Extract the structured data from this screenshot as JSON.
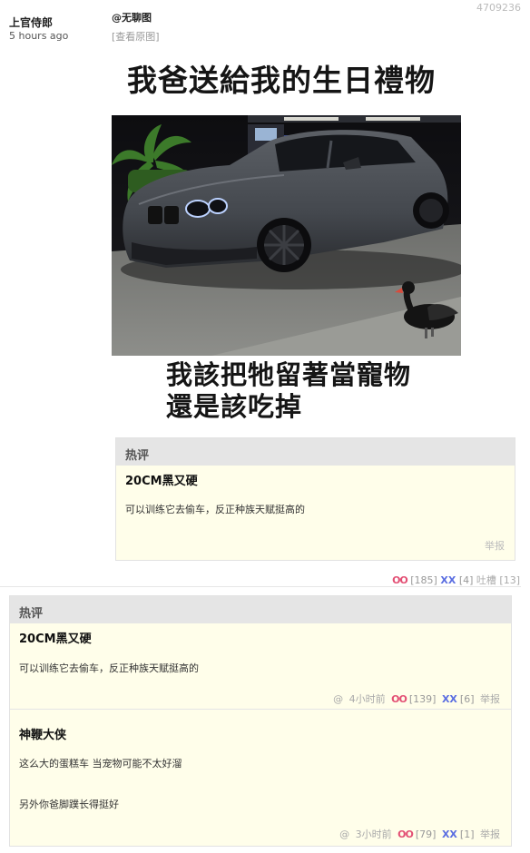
{
  "post": {
    "id": "4709236",
    "author": "上官侍郎",
    "time": "5 hours ago",
    "tag": "@无聊图",
    "view_original": "[查看原图]",
    "image": {
      "caption_top": "我爸送給我的生日禮物",
      "caption_bottom_1": "我該把牠留著當寵物",
      "caption_bottom_2": "還是該吃掉"
    },
    "votes": {
      "oo_label": "OO",
      "oo_count": "[185]",
      "xx_label": "XX",
      "xx_count": "[4]",
      "tucao": "吐槽 [13]"
    }
  },
  "hot_preview": {
    "heading": "热评",
    "author": "20CM黑又硬",
    "text": "可以训练它去偷车，反正种族天赋挺高的",
    "report": "举报"
  },
  "hot_comments": {
    "heading": "热评",
    "items": [
      {
        "author": "20CM黑又硬",
        "lines": [
          "可以训练它去偷车，反正种族天赋挺高的"
        ],
        "at": "@",
        "time": "4小时前",
        "oo": "OO",
        "oo_count": "[139]",
        "xx": "XX",
        "xx_count": "[6]",
        "report": "举报"
      },
      {
        "author": "神鞭大侠",
        "lines": [
          "这么大的蛋糕车 当宠物可能不太好溜",
          "另外你爸脚蹼长得挺好"
        ],
        "at": "@",
        "time": "3小时前",
        "oo": "OO",
        "oo_count": "[79]",
        "xx": "XX",
        "xx_count": "[1]",
        "report": "举报"
      }
    ]
  },
  "colors": {
    "oo": "#e34f74",
    "xx": "#5b6ee1",
    "hot_bg": "#fffeea",
    "hot_head": "#e5e5e5"
  }
}
